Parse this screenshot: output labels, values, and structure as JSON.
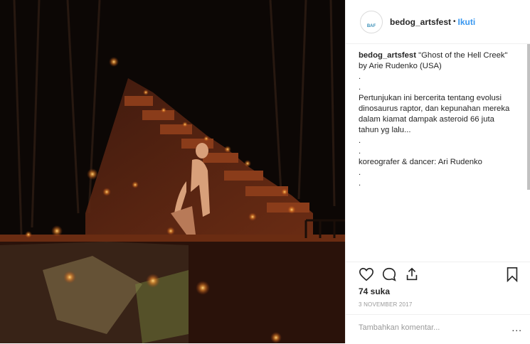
{
  "post": {
    "username": "bedog_artsfest",
    "separator": "•",
    "follow_label": "Ikuti",
    "avatar_text": "BAF",
    "caption": {
      "username": "bedog_artsfest",
      "lines": [
        "\"Ghost of the Hell Creek\" by Arie Rudenko (USA)",
        ".",
        ".",
        "Pertunjukan ini bercerita tentang evolusi dinosaurus raptor, dan kepunahan mereka dalam kiamat dampak asteroid 66 juta tahun yg lalu...",
        ".",
        ".",
        "koreografer & dancer: Ari Rudenko",
        ".",
        "."
      ]
    },
    "likes": "74 suka",
    "date": "3 NOVEMBER 2017",
    "comment_placeholder": "Tambahkan komentar...",
    "more_label": "..."
  }
}
